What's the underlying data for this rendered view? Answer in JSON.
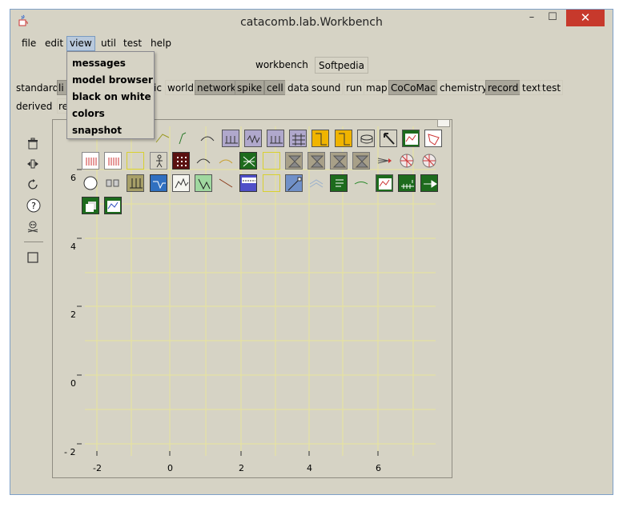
{
  "window": {
    "title": "catacomb.lab.Workbench",
    "minimize": "–",
    "maximize": "☐",
    "close": "✕"
  },
  "menubar": {
    "items": [
      "file",
      "edit",
      "view",
      "util",
      "test",
      "help"
    ],
    "active": "view"
  },
  "dropdown": {
    "items": [
      "messages",
      "model browser",
      "black on white",
      "colors",
      "snapshot"
    ]
  },
  "workbench_row": {
    "label": "workbench",
    "button": "Softpedia"
  },
  "standard_row": {
    "label": "standard",
    "buttons": [
      "world",
      "network",
      "spike",
      "cell",
      "data",
      "sound",
      "run",
      "map",
      "CoCoMac",
      "chemistry",
      "record",
      "text",
      "test"
    ],
    "partial_left": "li",
    "partial_mid": "ic"
  },
  "derived_row": {
    "label": "derived",
    "partial": "re"
  },
  "axes": {
    "y_ticks": [
      "6",
      "4",
      "2",
      "0",
      "- 2"
    ],
    "x_ticks": [
      "-2",
      "0",
      "2",
      "4",
      "6"
    ]
  },
  "colors": {
    "accent": "#b9c9dc",
    "selected_btn": "#a9a69a",
    "close": "#c7392c",
    "grid": "#e8e59a"
  }
}
